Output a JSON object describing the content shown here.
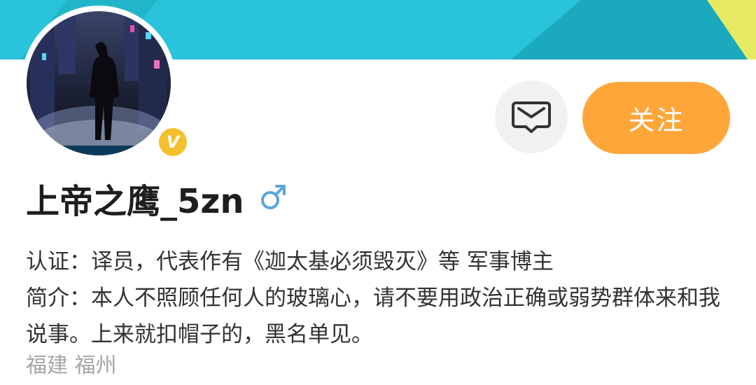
{
  "profile": {
    "username": "上帝之鹰_5zn",
    "gender_icon": "male-icon",
    "verified_badge": "V",
    "verification_label": "认证：",
    "verification_text": "译员，代表作有《迦太基必须毁灭》等 军事博主",
    "bio_label": "简介：",
    "bio_text": "本人不照顾任何人的玻璃心，请不要用政治正确或弱势群体来和我说事。上来就扣帽子的，黑名单见。",
    "location": "福建 福州"
  },
  "actions": {
    "message_icon": "message-icon",
    "follow_label": "关注"
  },
  "colors": {
    "banner_cyan": "#29c4db",
    "banner_teal": "#1aa9bd",
    "banner_yellow": "#e6ea63",
    "follow_orange": "#ffa63a",
    "verified_gold": "#f5c02e",
    "gender_blue": "#5aa5dc"
  }
}
